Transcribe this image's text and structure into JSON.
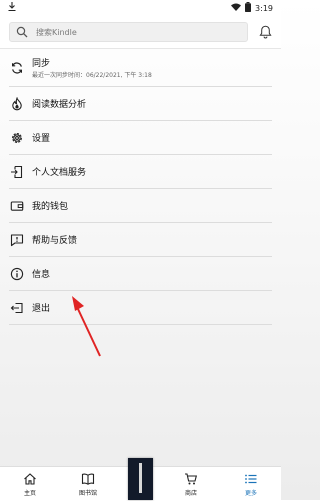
{
  "statusbar": {
    "time": "3:19"
  },
  "search": {
    "placeholder": "搜索Kindle"
  },
  "menu": {
    "sync": {
      "label": "同步",
      "last_sync": "最近一次同步时间：06/22/2021, 下午 3:18"
    },
    "reading_insights": {
      "label": "阅读数据分析"
    },
    "settings": {
      "label": "设置"
    },
    "personal_docs": {
      "label": "个人文档服务"
    },
    "wallet": {
      "label": "我的钱包"
    },
    "help": {
      "label": "帮助与反馈"
    },
    "info": {
      "label": "信息"
    },
    "sign_out": {
      "label": "退出"
    }
  },
  "bottom_nav": {
    "home": "主页",
    "library": "图书馆",
    "store": "商店",
    "more": "更多",
    "active": "more"
  },
  "colors": {
    "accent": "#1a73b8",
    "annotation_arrow": "#e02424"
  }
}
